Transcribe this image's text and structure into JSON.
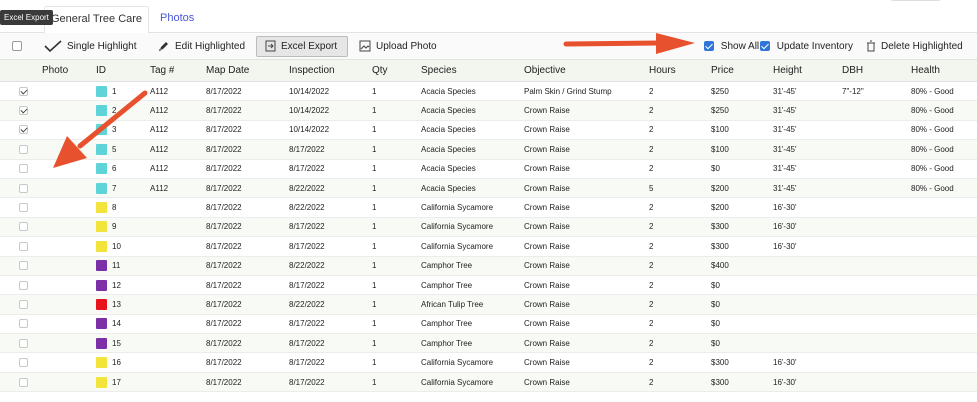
{
  "tooltip": "Excel Export",
  "tabs": [
    {
      "label": "General Tree Care",
      "active": true
    },
    {
      "label": "Photos",
      "active": false
    }
  ],
  "toolbar": {
    "single_highlight": "Single Highlight",
    "edit_highlighted": "Edit Highlighted",
    "excel_export": "Excel Export",
    "upload_photo": "Upload Photo",
    "show_all": "Show All",
    "show_all_checked": true,
    "update_inventory": "Update Inventory",
    "update_inventory_checked": true,
    "delete_highlighted": "Delete Highlighted"
  },
  "columns": [
    "Photo",
    "ID",
    "Tag #",
    "Map Date",
    "Inspection",
    "Qty",
    "Species",
    "Objective",
    "Hours",
    "Price",
    "Height",
    "DBH",
    "Health"
  ],
  "colors": {
    "cyan": "#5fd4d8",
    "yellow": "#f2e43a",
    "purple": "#7d2fa8",
    "red": "#e8141b",
    "arrow": "#e8512e",
    "accent": "#2f76d8"
  },
  "rows": [
    {
      "checked": true,
      "color": "cyan",
      "id": "1",
      "tag": "A112",
      "map_date": "8/17/2022",
      "inspection": "10/14/2022",
      "qty": "1",
      "species": "Acacia Species",
      "objective": "Palm Skin / Grind Stump",
      "hours": "2",
      "price": "$250",
      "height": "31'-45'",
      "dbh": "7\"-12\"",
      "health": "80% - Good"
    },
    {
      "checked": true,
      "color": "cyan",
      "id": "2",
      "tag": "A112",
      "map_date": "8/17/2022",
      "inspection": "10/14/2022",
      "qty": "1",
      "species": "Acacia Species",
      "objective": "Crown Raise",
      "hours": "2",
      "price": "$250",
      "height": "31'-45'",
      "dbh": "",
      "health": "80% - Good"
    },
    {
      "checked": true,
      "color": "cyan",
      "id": "3",
      "tag": "A112",
      "map_date": "8/17/2022",
      "inspection": "10/14/2022",
      "qty": "1",
      "species": "Acacia Species",
      "objective": "Crown Raise",
      "hours": "2",
      "price": "$100",
      "height": "31'-45'",
      "dbh": "",
      "health": "80% - Good"
    },
    {
      "checked": false,
      "color": "cyan",
      "id": "5",
      "tag": "A112",
      "map_date": "8/17/2022",
      "inspection": "8/17/2022",
      "qty": "1",
      "species": "Acacia Species",
      "objective": "Crown Raise",
      "hours": "2",
      "price": "$100",
      "height": "31'-45'",
      "dbh": "",
      "health": "80% - Good"
    },
    {
      "checked": false,
      "color": "cyan",
      "id": "6",
      "tag": "A112",
      "map_date": "8/17/2022",
      "inspection": "8/17/2022",
      "qty": "1",
      "species": "Acacia Species",
      "objective": "Crown Raise",
      "hours": "2",
      "price": "$0",
      "height": "31'-45'",
      "dbh": "",
      "health": "80% - Good"
    },
    {
      "checked": false,
      "color": "cyan",
      "id": "7",
      "tag": "A112",
      "map_date": "8/17/2022",
      "inspection": "8/22/2022",
      "qty": "1",
      "species": "Acacia Species",
      "objective": "Crown Raise",
      "hours": "5",
      "price": "$200",
      "height": "31'-45'",
      "dbh": "",
      "health": "80% - Good"
    },
    {
      "checked": false,
      "color": "yellow",
      "id": "8",
      "tag": "",
      "map_date": "8/17/2022",
      "inspection": "8/22/2022",
      "qty": "1",
      "species": "California Sycamore",
      "objective": "Crown Raise",
      "hours": "2",
      "price": "$200",
      "height": "16'-30'",
      "dbh": "",
      "health": ""
    },
    {
      "checked": false,
      "color": "yellow",
      "id": "9",
      "tag": "",
      "map_date": "8/17/2022",
      "inspection": "8/17/2022",
      "qty": "1",
      "species": "California Sycamore",
      "objective": "Crown Raise",
      "hours": "2",
      "price": "$300",
      "height": "16'-30'",
      "dbh": "",
      "health": ""
    },
    {
      "checked": false,
      "color": "yellow",
      "id": "10",
      "tag": "",
      "map_date": "8/17/2022",
      "inspection": "8/17/2022",
      "qty": "1",
      "species": "California Sycamore",
      "objective": "Crown Raise",
      "hours": "2",
      "price": "$300",
      "height": "16'-30'",
      "dbh": "",
      "health": ""
    },
    {
      "checked": false,
      "color": "purple",
      "id": "11",
      "tag": "",
      "map_date": "8/17/2022",
      "inspection": "8/22/2022",
      "qty": "1",
      "species": "Camphor Tree",
      "objective": "Crown Raise",
      "hours": "2",
      "price": "$400",
      "height": "",
      "dbh": "",
      "health": ""
    },
    {
      "checked": false,
      "color": "purple",
      "id": "12",
      "tag": "",
      "map_date": "8/17/2022",
      "inspection": "8/17/2022",
      "qty": "1",
      "species": "Camphor Tree",
      "objective": "Crown Raise",
      "hours": "2",
      "price": "$0",
      "height": "",
      "dbh": "",
      "health": ""
    },
    {
      "checked": false,
      "color": "red",
      "id": "13",
      "tag": "",
      "map_date": "8/17/2022",
      "inspection": "8/22/2022",
      "qty": "1",
      "species": "African Tulip Tree",
      "objective": "Crown Raise",
      "hours": "2",
      "price": "$0",
      "height": "",
      "dbh": "",
      "health": ""
    },
    {
      "checked": false,
      "color": "purple",
      "id": "14",
      "tag": "",
      "map_date": "8/17/2022",
      "inspection": "8/17/2022",
      "qty": "1",
      "species": "Camphor Tree",
      "objective": "Crown Raise",
      "hours": "2",
      "price": "$0",
      "height": "",
      "dbh": "",
      "health": ""
    },
    {
      "checked": false,
      "color": "purple",
      "id": "15",
      "tag": "",
      "map_date": "8/17/2022",
      "inspection": "8/17/2022",
      "qty": "1",
      "species": "Camphor Tree",
      "objective": "Crown Raise",
      "hours": "2",
      "price": "$0",
      "height": "",
      "dbh": "",
      "health": ""
    },
    {
      "checked": false,
      "color": "yellow",
      "id": "16",
      "tag": "",
      "map_date": "8/17/2022",
      "inspection": "8/17/2022",
      "qty": "1",
      "species": "California Sycamore",
      "objective": "Crown Raise",
      "hours": "2",
      "price": "$300",
      "height": "16'-30'",
      "dbh": "",
      "health": ""
    },
    {
      "checked": false,
      "color": "yellow",
      "id": "17",
      "tag": "",
      "map_date": "8/17/2022",
      "inspection": "8/17/2022",
      "qty": "1",
      "species": "California Sycamore",
      "objective": "Crown Raise",
      "hours": "2",
      "price": "$300",
      "height": "16'-30'",
      "dbh": "",
      "health": ""
    }
  ]
}
